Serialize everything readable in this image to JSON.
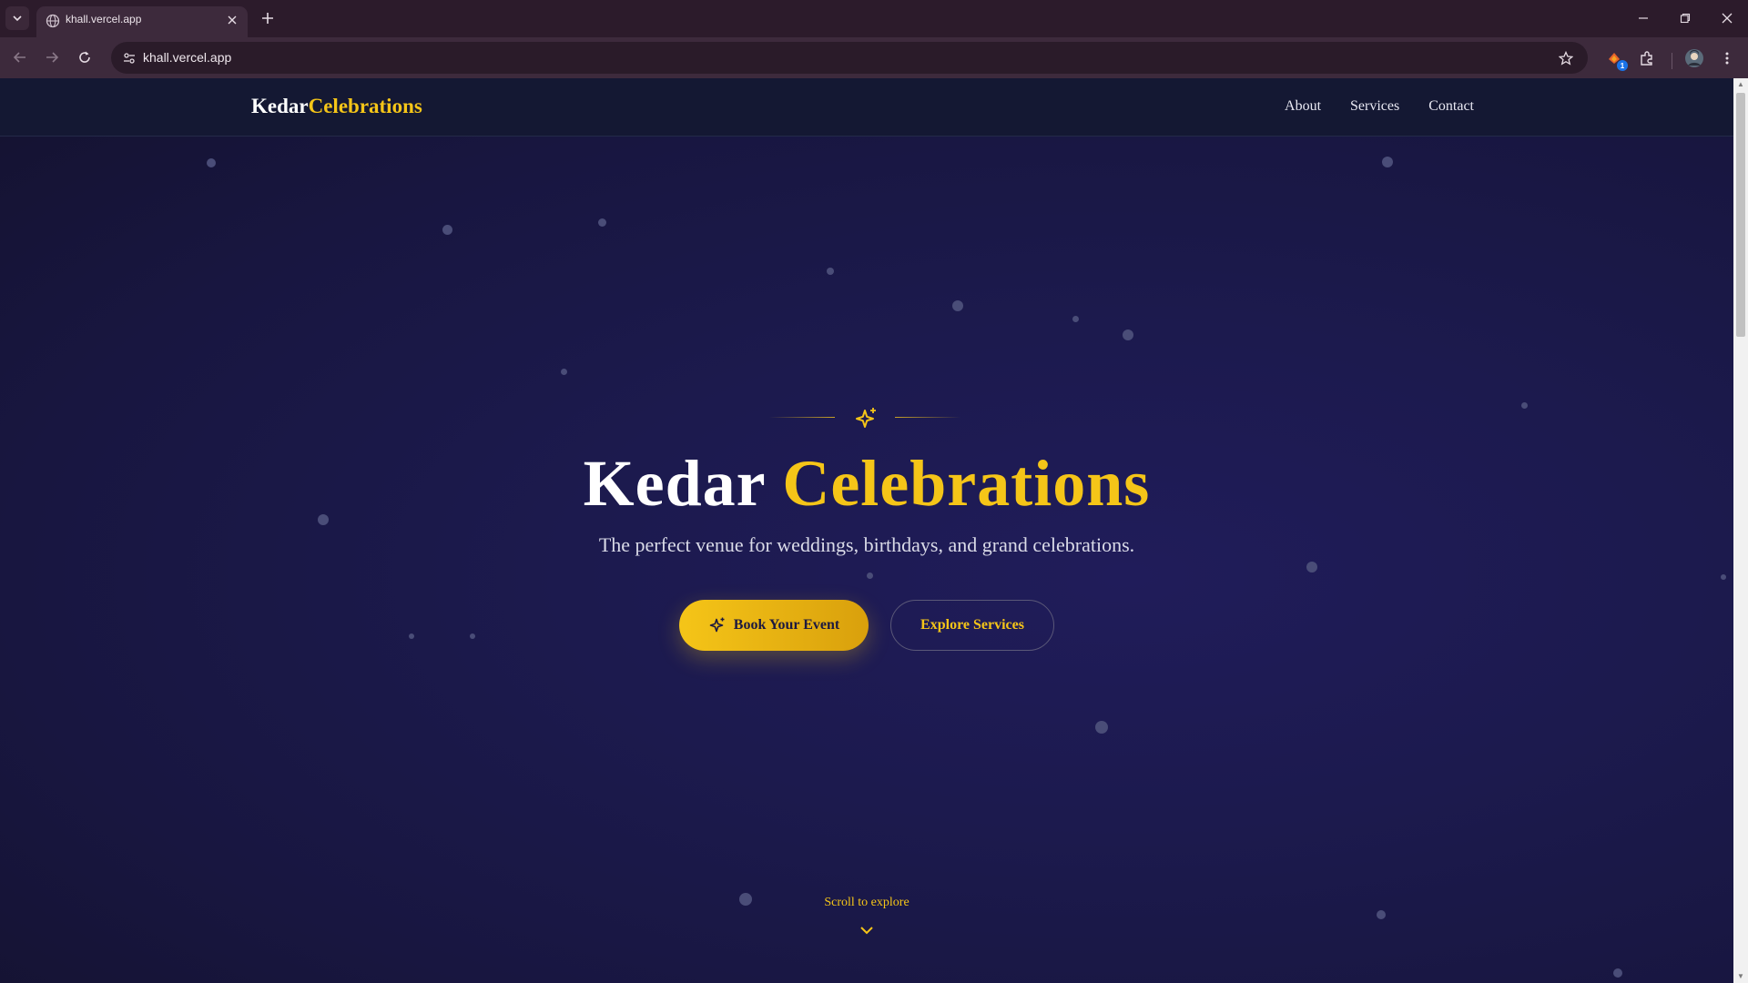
{
  "browser": {
    "tab_title": "khall.vercel.app",
    "url": "khall.vercel.app",
    "extension_badge": "1"
  },
  "site": {
    "brand_part1": "Kedar",
    "brand_part2": "Celebrations",
    "nav": [
      {
        "label": "About"
      },
      {
        "label": "Services"
      },
      {
        "label": "Contact"
      }
    ]
  },
  "hero": {
    "title_part1": "Kedar",
    "title_part2": "Celebrations",
    "subtitle": "The perfect venue for weddings, birthdays, and grand celebrations.",
    "primary_button": "Book Your Event",
    "secondary_button": "Explore Services",
    "scroll_hint": "Scroll to explore"
  },
  "colors": {
    "accent_gold": "#f5c518",
    "background_navy": "#1c1a4e",
    "chrome_bg": "#2c1b2b"
  },
  "icons": [
    "chevron-down-icon",
    "globe-icon",
    "close-icon",
    "plus-icon",
    "minimize-icon",
    "restore-icon",
    "back-icon",
    "forward-icon",
    "reload-icon",
    "site-info-icon",
    "star-icon",
    "extension-icon",
    "puzzle-icon",
    "avatar",
    "kebab-menu-icon",
    "sparkles-icon"
  ]
}
